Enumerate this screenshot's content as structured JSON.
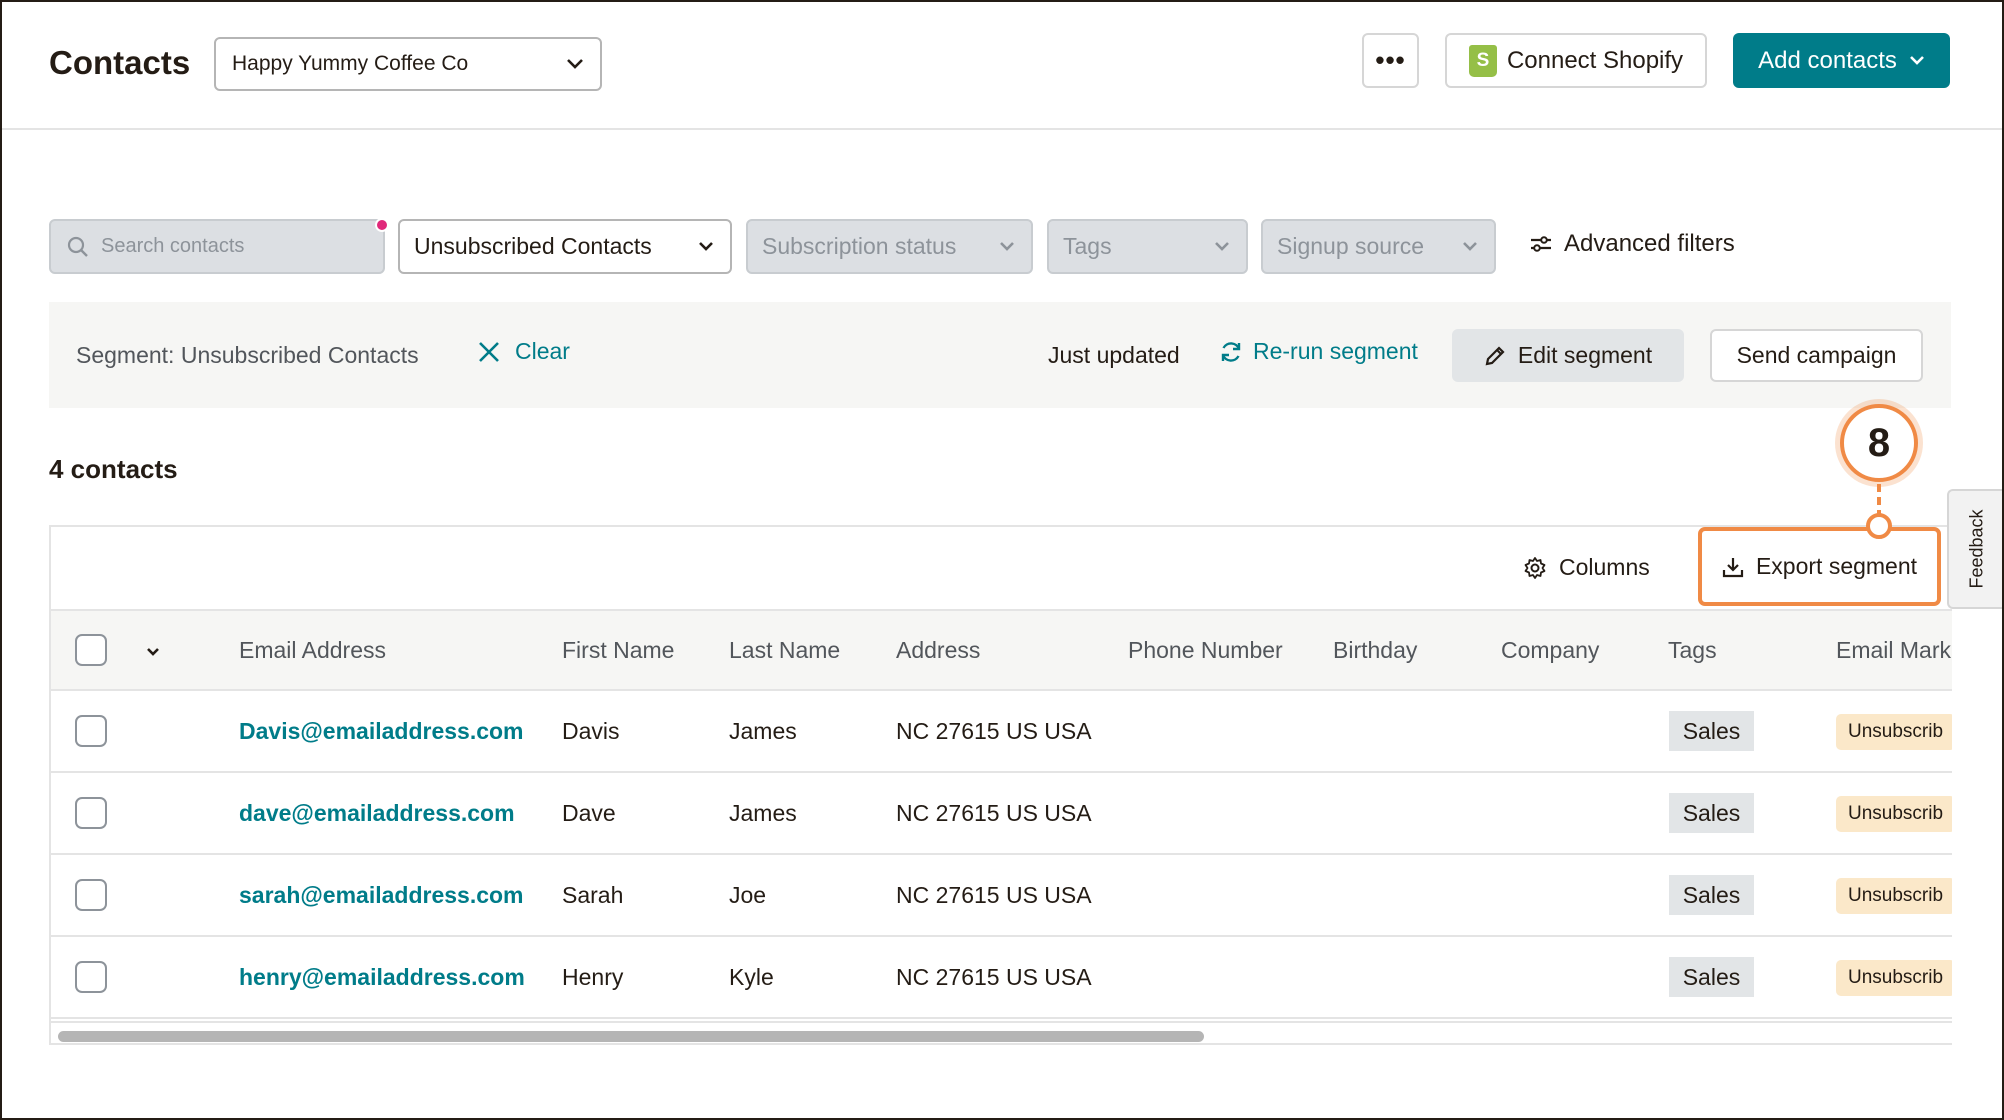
{
  "header": {
    "title": "Contacts",
    "audience": "Happy Yummy Coffee Co",
    "more_label": "•••",
    "shopify_label": "Connect Shopify",
    "add_contacts_label": "Add contacts"
  },
  "filters": {
    "search_placeholder": "Search contacts",
    "segment_value": "Unsubscribed Contacts",
    "subscription_status": "Subscription status",
    "tags": "Tags",
    "signup_source": "Signup source",
    "advanced": "Advanced filters"
  },
  "segment_bar": {
    "label": "Segment: Unsubscribed Contacts",
    "clear": "Clear",
    "updated": "Just updated",
    "rerun": "Re-run segment",
    "edit": "Edit segment",
    "send": "Send campaign"
  },
  "count_label": "4 contacts",
  "table": {
    "columns_label": "Columns",
    "export_label": "Export segment",
    "headers": {
      "email": "Email Address",
      "first": "First Name",
      "last": "Last Name",
      "address": "Address",
      "phone": "Phone Number",
      "birthday": "Birthday",
      "company": "Company",
      "tags": "Tags",
      "marketing": "Email Mark"
    },
    "rows": [
      {
        "email": "Davis@emailaddress.com",
        "first": "Davis",
        "last": "James",
        "address": "NC 27615 US USA",
        "tag": "Sales",
        "status": "Unsubscrib"
      },
      {
        "email": "dave@emailaddress.com",
        "first": "Dave",
        "last": "James",
        "address": "NC 27615 US USA",
        "tag": "Sales",
        "status": "Unsubscrib"
      },
      {
        "email": "sarah@emailaddress.com",
        "first": "Sarah",
        "last": "Joe",
        "address": "NC 27615 US USA",
        "tag": "Sales",
        "status": "Unsubscrib"
      },
      {
        "email": "henry@emailaddress.com",
        "first": "Henry",
        "last": "Kyle",
        "address": "NC 27615 US USA",
        "tag": "Sales",
        "status": "Unsubscrib"
      }
    ]
  },
  "callout": {
    "number": "8"
  },
  "feedback_label": "Feedback",
  "colors": {
    "brand": "#007c89",
    "callout": "#f08a45",
    "unsubscribed_badge": "#fbe8c9"
  },
  "icons": [
    "chevron-down-icon",
    "shopify-bag-icon",
    "search-icon",
    "sliders-icon",
    "close-icon",
    "refresh-icon",
    "pencil-icon",
    "gear-icon",
    "download-icon"
  ]
}
